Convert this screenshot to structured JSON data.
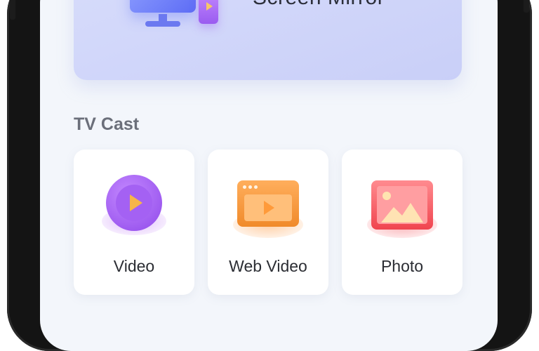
{
  "hero": {
    "title": "Screen Mirror",
    "gradient_start": "#d7dcfb",
    "gradient_end": "#c9cff8",
    "illustration_icon": "monitor-phone-icon"
  },
  "section": {
    "title": "TV Cast"
  },
  "cards": [
    {
      "label": "Video",
      "icon": "video-play-icon",
      "accent": "#a461f3"
    },
    {
      "label": "Web Video",
      "icon": "web-video-icon",
      "accent": "#f08a2a"
    },
    {
      "label": "Photo",
      "icon": "photo-icon",
      "accent": "#f0454f"
    }
  ]
}
